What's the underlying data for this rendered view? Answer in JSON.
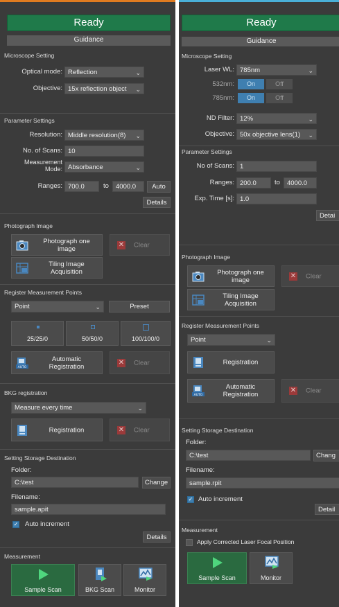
{
  "left": {
    "status": "Ready",
    "guidance": "Guidance",
    "microscope": {
      "title": "Microscope Setting",
      "optical_mode_label": "Optical mode:",
      "optical_mode_value": "Reflection",
      "objective_label": "Objective:",
      "objective_value": "15x reflection object"
    },
    "parameter": {
      "title": "Parameter Settings",
      "resolution_label": "Resolution:",
      "resolution_value": "Middle resolution(8)",
      "scans_label": "No. of Scans:",
      "scans_value": "10",
      "mode_label_1": "Measurement",
      "mode_label_2": "Mode:",
      "mode_value": "Absorbance",
      "ranges_label": "Ranges:",
      "range_from": "700.0",
      "range_to_word": "to",
      "range_to": "4000.0",
      "auto_label": "Auto",
      "details_label": "Details"
    },
    "photo": {
      "title": "Photograph Image",
      "photo_one_1": "Photograph one",
      "photo_one_2": "image",
      "clear_label": "Clear",
      "tiling_1": "Tiling Image",
      "tiling_2": "Acquisition"
    },
    "register": {
      "title": "Register Measurement Points",
      "type_value": "Point",
      "preset_label": "Preset",
      "points": [
        "25/25/0",
        "50/50/0",
        "100/100/0"
      ],
      "auto_reg_1": "Automatic",
      "auto_reg_2": "Registration",
      "clear_label": "Clear"
    },
    "bkg": {
      "title": "BKG registration",
      "mode_value": "Measure every time",
      "registration_label": "Registration",
      "clear_label": "Clear"
    },
    "storage": {
      "title": "Setting Storage Destination",
      "folder_label": "Folder:",
      "folder_value": "C:\\test",
      "change_label": "Change",
      "filename_label": "Filename:",
      "filename_value": "sample.apit",
      "auto_increment_label": "Auto increment",
      "details_label": "Details"
    },
    "measurement": {
      "title": "Measurement",
      "sample_scan": "Sample Scan",
      "bkg_scan": "BKG Scan",
      "monitor": "Monitor"
    }
  },
  "right": {
    "status": "Ready",
    "guidance": "Guidance",
    "microscope": {
      "title": "Microscope Setting",
      "laser_label": "Laser WL:",
      "laser_value": "785nm",
      "l532_label": "532nm:",
      "l785_label": "785nm:",
      "on_label": "On",
      "off_label": "Off",
      "nd_label": "ND Filter:",
      "nd_value": "12%",
      "objective_label": "Objective:",
      "objective_value": "50x objective lens(1)"
    },
    "parameter": {
      "title": "Parameter Settings",
      "scans_label": "No of Scans:",
      "scans_value": "1",
      "ranges_label": "Ranges:",
      "range_from": "200.0",
      "range_to_word": "to",
      "range_to": "4000.0",
      "exp_label": "Exp. Time [s]:",
      "exp_value": "1.0",
      "details_label": "Detai"
    },
    "photo": {
      "title": "Photograph Image",
      "photo_one_1": "Photograph one",
      "photo_one_2": "image",
      "clear_label": "Clear",
      "tiling_1": "Tiling Image",
      "tiling_2": "Acquisition"
    },
    "register": {
      "title": "Register Measurement Points",
      "type_value": "Point",
      "registration_label": "Registration",
      "auto_reg_1": "Automatic",
      "auto_reg_2": "Registration",
      "clear_label": "Clear"
    },
    "storage": {
      "title": "Setting Storage Destination",
      "folder_label": "Folder:",
      "folder_value": "C:\\test",
      "change_label": "Chang",
      "filename_label": "Filename:",
      "filename_value": "sample.rpit",
      "auto_increment_label": "Auto increment",
      "details_label": "Detail"
    },
    "measurement": {
      "title": "Measurement",
      "apply_label": "Apply Corrected Laser Focal Position",
      "sample_scan": "Sample Scan",
      "monitor": "Monitor"
    }
  },
  "colors": {
    "panel": "#3b3b3b",
    "ready_green": "#1f7a4a",
    "accent_blue": "#3f7fb0",
    "clear_red": "#9b3a3a",
    "left_top_bar": "#e07b20",
    "right_top_bar": "#4ab0d8"
  },
  "icons": [
    "camera-icon",
    "tiling-icon",
    "auto-registration-icon",
    "registration-icon",
    "clear-x-icon",
    "play-icon",
    "bkg-scan-icon",
    "monitor-icon",
    "chevron-down-icon",
    "checkmark-icon"
  ]
}
